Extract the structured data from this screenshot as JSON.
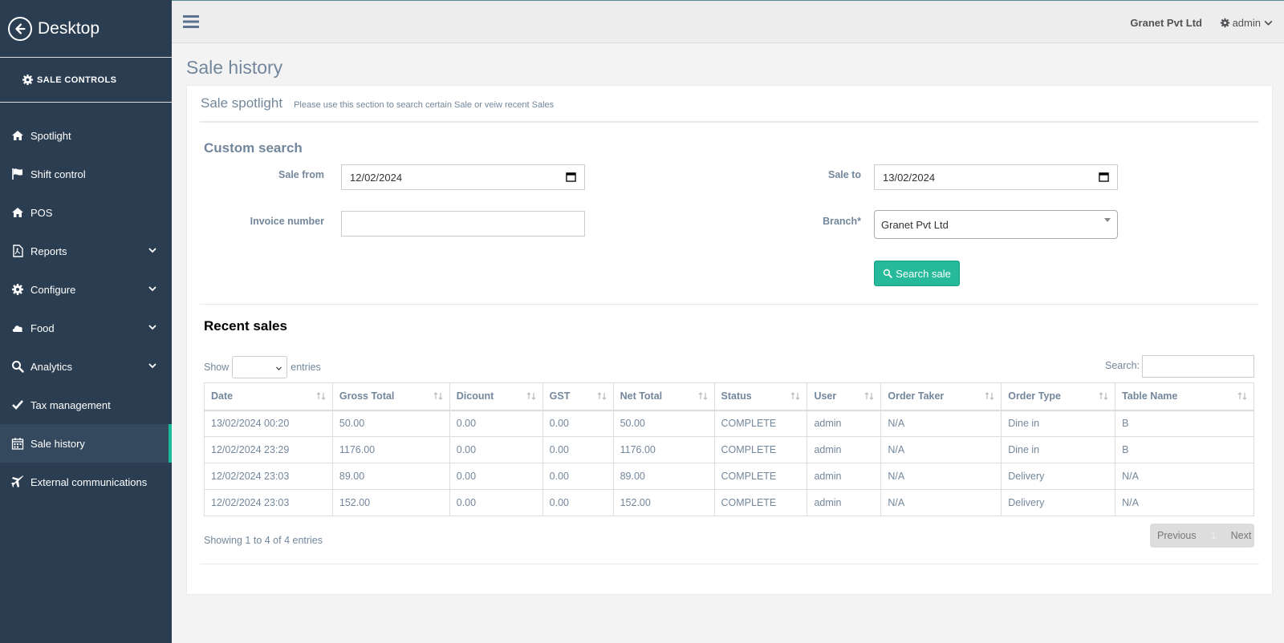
{
  "sidebar": {
    "brand": "Desktop",
    "controls_label": "SALE CONTROLS",
    "items": [
      {
        "label": "Spotlight"
      },
      {
        "label": "Shift control"
      },
      {
        "label": "POS"
      },
      {
        "label": "Reports"
      },
      {
        "label": "Configure"
      },
      {
        "label": "Food"
      },
      {
        "label": "Analytics"
      },
      {
        "label": "Tax management"
      },
      {
        "label": "Sale history"
      },
      {
        "label": "External communications"
      }
    ]
  },
  "topbar": {
    "company": "Granet Pvt Ltd",
    "user": "admin"
  },
  "page_title": "Sale history",
  "panel": {
    "title": "Sale spotlight",
    "subtitle": "Please use this section to search certain Sale or veiw recent Sales"
  },
  "custom_search": {
    "title": "Custom search",
    "sale_from_label": "Sale from",
    "sale_from_value": "12/02/2024",
    "sale_to_label": "Sale to",
    "sale_to_value": "13/02/2024",
    "invoice_label": "Invoice number",
    "invoice_value": "",
    "branch_label": "Branch*",
    "branch_value": "Granet Pvt Ltd",
    "search_button": "Search sale"
  },
  "recent": {
    "title": "Recent sales",
    "show_label": "Show",
    "entries_label": "entries",
    "search_label": "Search:",
    "columns": [
      "Date",
      "Gross Total",
      "Dicount",
      "GST",
      "Net Total",
      "Status",
      "User",
      "Order Taker",
      "Order Type",
      "Table Name"
    ],
    "rows": [
      [
        "13/02/2024 00:20",
        "50.00",
        "0.00",
        "0.00",
        "50.00",
        "COMPLETE",
        "admin",
        "N/A",
        "Dine in",
        "B"
      ],
      [
        "12/02/2024 23:29",
        "1176.00",
        "0.00",
        "0.00",
        "1176.00",
        "COMPLETE",
        "admin",
        "N/A",
        "Dine in",
        "B"
      ],
      [
        "12/02/2024 23:03",
        "89.00",
        "0.00",
        "0.00",
        "89.00",
        "COMPLETE",
        "admin",
        "N/A",
        "Delivery",
        "N/A"
      ],
      [
        "12/02/2024 23:03",
        "152.00",
        "0.00",
        "0.00",
        "152.00",
        "COMPLETE",
        "admin",
        "N/A",
        "Delivery",
        "N/A"
      ]
    ],
    "showing": "Showing 1 to 4 of 4 entries",
    "pager": {
      "previous": "Previous",
      "current": "1",
      "next": "Next"
    }
  },
  "colors": {
    "sidebar_bg": "#2b3d51",
    "accent": "#26b99a",
    "text_muted": "#73879c"
  }
}
